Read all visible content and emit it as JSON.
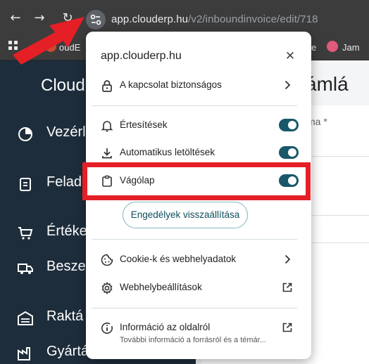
{
  "browser": {
    "url_host": "app.clouderp.hu",
    "url_path": "/v2/inboundinvoice/edit/718",
    "bookmarks": [
      {
        "label": "oudE",
        "color": "#c84b31"
      },
      {
        "label": "e",
        "color": ""
      },
      {
        "label": "Jam",
        "color": "#e05a7a"
      }
    ]
  },
  "app": {
    "brand": "Cloud",
    "sidebar": [
      {
        "label": "Vezérl",
        "icon": "dashboard-icon"
      },
      {
        "label": "Felad",
        "icon": "clipboard-icon"
      },
      {
        "label": "Értéke",
        "icon": "cart-icon"
      },
      {
        "label": "Besze",
        "icon": "truck-icon"
      },
      {
        "label": "Raktá",
        "icon": "warehouse-icon"
      },
      {
        "label": "Gyártá",
        "icon": "factory-icon"
      }
    ],
    "main_title": "zámlá",
    "main_field": "ma *"
  },
  "popup": {
    "title": "app.clouderp.hu",
    "connection": "A kapcsolat biztonságos",
    "permissions": [
      {
        "label": "Értesítések",
        "icon": "bell-icon",
        "enabled": true
      },
      {
        "label": "Automatikus letöltések",
        "icon": "download-icon",
        "enabled": true
      },
      {
        "label": "Vágólap",
        "icon": "clipboard-icon",
        "enabled": true
      }
    ],
    "reset_label": "Engedélyek visszaállítása",
    "cookies": "Cookie-k és webhelyadatok",
    "site_settings": "Webhelybeállítások",
    "about_title": "Információ az oldalról",
    "about_sub": "További információ a forrásról és a témár..."
  },
  "colors": {
    "toggle_on": "#19576b",
    "highlight": "#e41f26",
    "sidebar_bg": "#1e2d3b"
  }
}
